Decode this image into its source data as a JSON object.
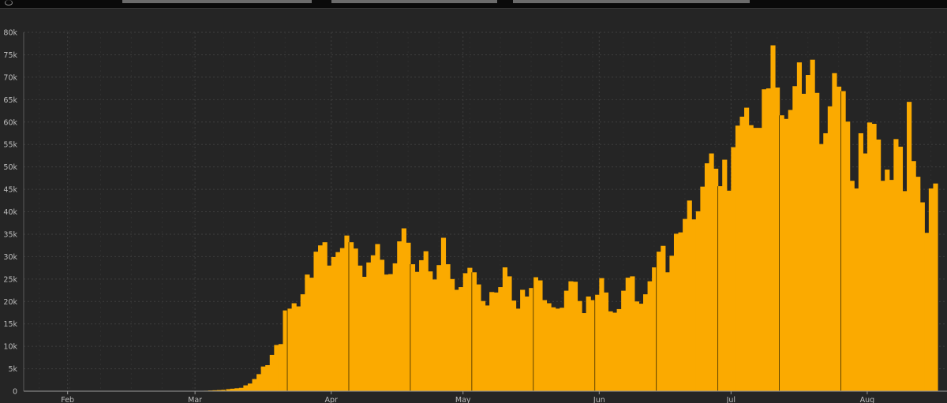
{
  "chart_data": {
    "type": "bar",
    "title": "",
    "xlabel": "",
    "ylabel": "",
    "ylim": [
      0,
      80000
    ],
    "yticks": [
      0,
      5000,
      10000,
      15000,
      20000,
      25000,
      30000,
      35000,
      40000,
      45000,
      50000,
      55000,
      60000,
      65000,
      70000,
      75000,
      80000
    ],
    "ytick_labels": [
      "0",
      "5k",
      "10k",
      "15k",
      "20k",
      "25k",
      "30k",
      "35k",
      "40k",
      "45k",
      "50k",
      "55k",
      "60k",
      "65k",
      "70k",
      "75k",
      "80k"
    ],
    "x_range": [
      "2020-01-22",
      "2020-08-04"
    ],
    "xticks": [
      {
        "label": "Feb",
        "date": "2020-02-01"
      },
      {
        "label": "Mar",
        "date": "2020-03-01"
      },
      {
        "label": "Apr",
        "date": "2020-04-01"
      },
      {
        "label": "May",
        "date": "2020-05-01"
      },
      {
        "label": "Jun",
        "date": "2020-06-01"
      },
      {
        "label": "Jul",
        "date": "2020-07-01"
      },
      {
        "label": "Aug",
        "date": "2020-08-01"
      }
    ],
    "grid": true,
    "bar_color": "#fbaa00",
    "series": [
      {
        "values": [
          0,
          0,
          0,
          0,
          0,
          0,
          0,
          0,
          0,
          0,
          0,
          0,
          0,
          0,
          0,
          0,
          0,
          0,
          0,
          0,
          0,
          0,
          0,
          0,
          0,
          0,
          0,
          0,
          0,
          0,
          0,
          0,
          0,
          0,
          0,
          0,
          10,
          20,
          20,
          30,
          60,
          100,
          150,
          200,
          250,
          300,
          450,
          550,
          650,
          750,
          1300,
          1700,
          2700,
          3800,
          5500,
          5800,
          8100,
          10300,
          10500,
          18000,
          18400,
          19600,
          18900,
          21600,
          26000,
          25300,
          31100,
          32500,
          33200,
          28000,
          29900,
          31000,
          31900,
          34700,
          33200,
          31800,
          28000,
          25500,
          28700,
          30300,
          32800,
          29300,
          26000,
          26100,
          28500,
          33400,
          36300,
          33100,
          28300,
          26600,
          29200,
          31200,
          26700,
          24900,
          28100,
          34200,
          28300,
          25000,
          22600,
          23200,
          26300,
          27500,
          26500,
          23800,
          20100,
          19100,
          22100,
          22000,
          23200,
          27600,
          25600,
          20200,
          18400,
          22600,
          21100,
          23000,
          25400,
          24700,
          20300,
          19600,
          18700,
          18400,
          18600,
          22400,
          24500,
          24400,
          20100,
          17400,
          21100,
          20300,
          21500,
          25200,
          22000,
          17800,
          17500,
          18300,
          22400,
          25300,
          25600,
          20000,
          19500,
          21600,
          24500,
          27600,
          31100,
          32400,
          26500,
          30200,
          35100,
          35400,
          38400,
          42500,
          38300,
          40100,
          45600,
          50800,
          53000,
          49600,
          45700,
          51600,
          44700,
          54400,
          59200,
          61200,
          63200,
          59300,
          58700,
          58700,
          67300,
          67500,
          77100,
          67700,
          61500,
          60700,
          62700,
          68000,
          73300,
          66300,
          70500,
          73900,
          66500,
          55100,
          57500,
          63500,
          70900,
          67900,
          66900,
          60100,
          46900,
          45200,
          57500,
          53000,
          59900,
          59600,
          56100,
          46900,
          49400,
          47100,
          56200,
          54500,
          44600,
          64500,
          51300,
          47800,
          42100,
          35300,
          45200,
          46300
        ]
      }
    ]
  }
}
